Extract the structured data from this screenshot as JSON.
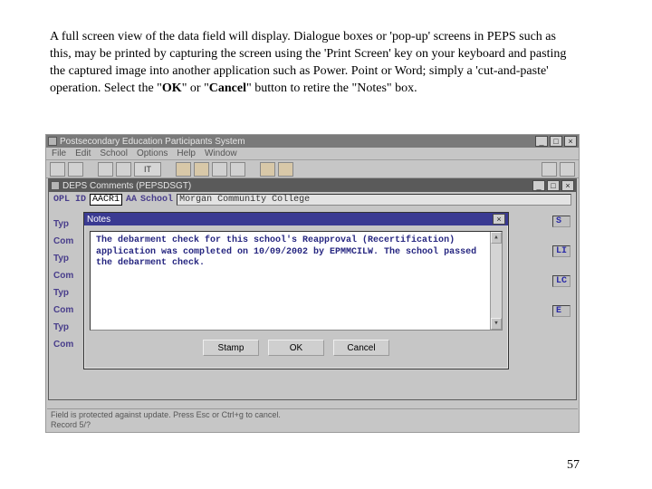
{
  "caption_html": "A full screen view of the data field will display. Dialogue boxes or 'pop-up' screens in PEPS such as this, may be printed by capturing the screen using the 'Print Screen' key on your keyboard and pasting the captured image into another application such as Power. Point or Word;  simply a 'cut-and-paste' operation. Select the \"<b>OK</b>\" or \"<b>Cancel</b>\" button to retire the \"Notes\" box.",
  "page_number": "57",
  "outer_window": {
    "title": "Postsecondary Education Participants System",
    "menu": [
      "File",
      "Edit",
      "School",
      "Options",
      "Help",
      "Window"
    ],
    "toolbar_group_label": "IT"
  },
  "inner_window": {
    "title": "DEPS Comments (PEPSDSGT)",
    "opl_lbl": "OPL ID",
    "opl_val": "AACR1",
    "aa_lbl": "AA",
    "school_lbl": "School",
    "school_val": "Morgan Community College",
    "sidelabels": [
      "Typ",
      "Com",
      "Typ",
      "Com",
      "Typ",
      "Com",
      "Typ",
      "Com"
    ],
    "codes": [
      "S",
      "LI",
      "LC",
      "E"
    ]
  },
  "notes": {
    "title": "Notes",
    "text": "The debarment check for this school's Reapproval (Recertification) application was completed on 10/09/2002 by EPMMCILW. The school passed the debarment check.",
    "buttons": {
      "stamp": "Stamp",
      "ok": "OK",
      "cancel": "Cancel"
    }
  },
  "statusbar": {
    "line1": "Field is protected against update. Press Esc or Ctrl+g to cancel.",
    "line2": "Record 5/?"
  }
}
